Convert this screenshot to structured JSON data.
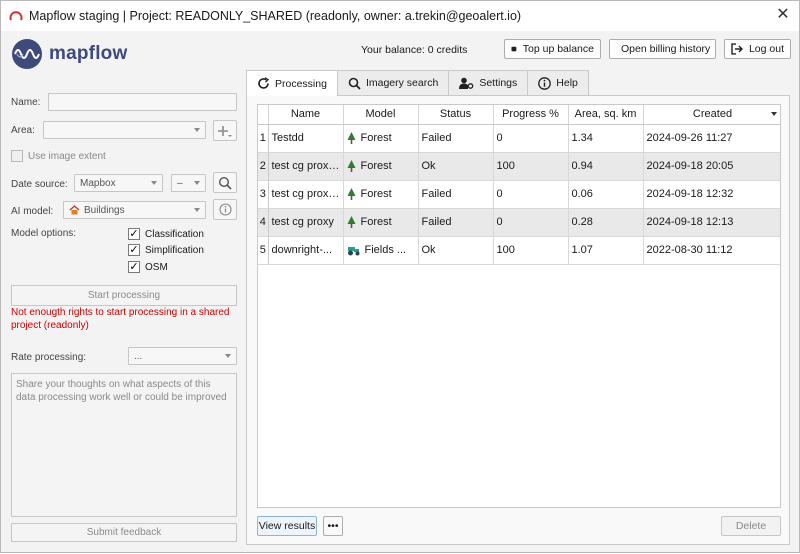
{
  "window": {
    "title": "Mapflow staging | Project: READONLY_SHARED (readonly, owner: a.trekin@geoalert.io)",
    "close_glyph": "✕"
  },
  "header": {
    "logo_text": "mapflow",
    "balance": "Your balance: 0 credits",
    "top_up_label": "Top up balance",
    "billing_label": "Open billing history",
    "logout_label": "Log out"
  },
  "left": {
    "name_label": "Name:",
    "name_value": "",
    "area_label": "Area:",
    "area_value": "",
    "use_image_extent_label": "Use image extent",
    "data_source_label": "Date source:",
    "data_source_value": "Mapbox",
    "data_source_extra": "–",
    "ai_model_label": "AI model:",
    "ai_model_value": "Buildings",
    "model_options_label": "Model options:",
    "options": [
      {
        "label": "Classification",
        "checked": true
      },
      {
        "label": "Simplification",
        "checked": true
      },
      {
        "label": "OSM",
        "checked": true
      }
    ],
    "check_glyph": "✓",
    "start_processing_label": "Start processing",
    "warning": "Not enougth rights to start processing in a shared project (readonly)",
    "rate_label": "Rate processing:",
    "rate_value": "...",
    "feedback_placeholder": "Share your thoughts on what aspects of this data processing work well or could be improved",
    "submit_feedback_label": "Submit feedback"
  },
  "tabs": [
    {
      "label": "Processing",
      "icon": "refresh-icon",
      "active": true
    },
    {
      "label": "Imagery search",
      "icon": "search-icon",
      "active": false
    },
    {
      "label": "Settings",
      "icon": "user-gear-icon",
      "active": false
    },
    {
      "label": "Help",
      "icon": "info-icon",
      "active": false
    }
  ],
  "table": {
    "columns": [
      "Name",
      "Model",
      "Status",
      "Progress %",
      "Area, sq. km",
      "Created"
    ],
    "rows": [
      {
        "n": "1",
        "name": "Testdd",
        "model": "Forest",
        "model_icon": "tree-icon",
        "status": "Failed",
        "progress": "0",
        "area": "1.34",
        "created": "2024-09-26 11:27"
      },
      {
        "n": "2",
        "name": "test cg proxy...",
        "model": "Forest",
        "model_icon": "tree-icon",
        "status": "Ok",
        "progress": "100",
        "area": "0.94",
        "created": "2024-09-18 20:05"
      },
      {
        "n": "3",
        "name": "test cg proxy...",
        "model": "Forest",
        "model_icon": "tree-icon",
        "status": "Failed",
        "progress": "0",
        "area": "0.06",
        "created": "2024-09-18 12:32"
      },
      {
        "n": "4",
        "name": "test cg proxy",
        "model": "Forest",
        "model_icon": "tree-icon",
        "status": "Failed",
        "progress": "0",
        "area": "0.28",
        "created": "2024-09-18 12:13"
      },
      {
        "n": "5",
        "name": "downright-...",
        "model": "Fields ...",
        "model_icon": "tractor-icon",
        "status": "Ok",
        "progress": "100",
        "area": "1.07",
        "created": "2022-08-30 11:12"
      }
    ]
  },
  "footer": {
    "view_results_label": "View results",
    "more_label": "•••",
    "delete_label": "Delete"
  },
  "colors": {
    "warning": "#cc0000",
    "logo": "#3e4a7a",
    "tree": "#2e7d32",
    "tractor": "#2a9d8f"
  }
}
